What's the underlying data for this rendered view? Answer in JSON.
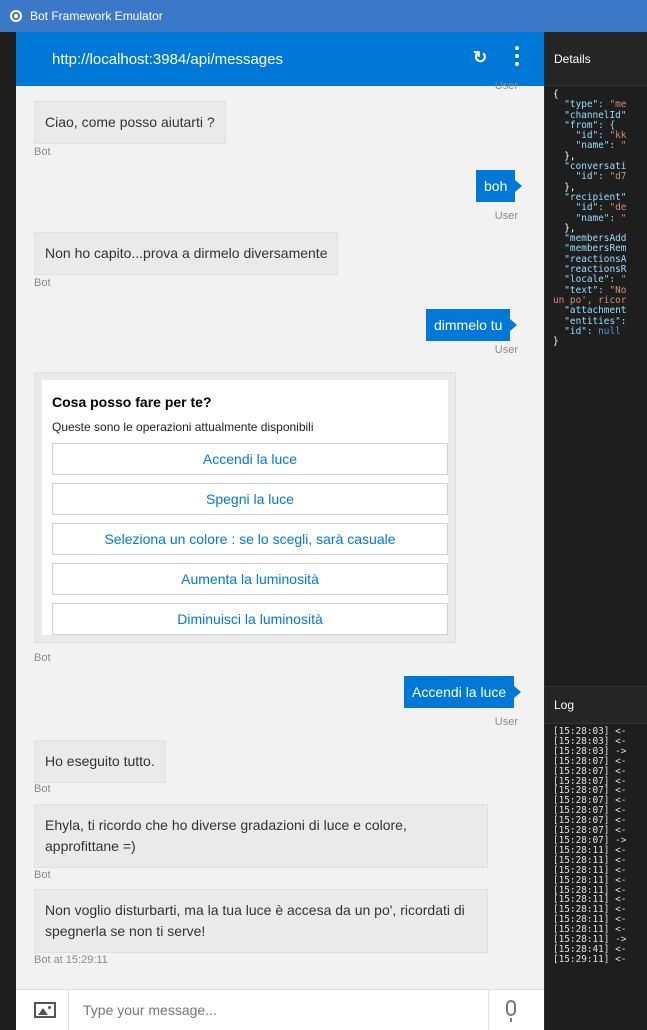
{
  "window": {
    "title": "Bot Framework Emulator"
  },
  "chat": {
    "endpoint": "http://localhost:3984/api/messages",
    "composer_placeholder": "Type your message...",
    "user_label": "User",
    "bot_label": "Bot",
    "last_bot_label": "Bot at 15:29:11",
    "messages": {
      "m1": "Ciao, come posso aiutarti ?",
      "m2": "boh",
      "m3": "Non ho capito...prova a dirmelo diversamente",
      "m4": "dimmelo tu",
      "m5": "Accendi la luce",
      "m6": "Ho eseguito tutto.",
      "m7": "Ehyla, ti ricordo che ho diverse gradazioni di luce e colore, approfittane =)",
      "m8": "Non voglio disturbarti, ma la tua luce è accesa da un po', ricordati di spegnerla se non ti serve!"
    },
    "card": {
      "title": "Cosa posso fare per te?",
      "subtitle": "Queste sono le operazioni attualmente disponibili",
      "buttons": [
        "Accendi la luce",
        "Spegni la luce",
        "Seleziona un colore : se lo scegli, sarà casuale",
        "Aumenta la luminosità",
        "Diminuisci la luminosità"
      ]
    }
  },
  "details": {
    "title": "Details",
    "json_lines": [
      [
        "{",
        ""
      ],
      [
        "  \"type\": ",
        "\"me"
      ],
      [
        "  \"channelId\"",
        ""
      ],
      [
        "  \"from\": {",
        ""
      ],
      [
        "    \"id\": ",
        "\"kk"
      ],
      [
        "    \"name\": ",
        "\""
      ],
      [
        "  },",
        ""
      ],
      [
        "  \"conversati",
        ""
      ],
      [
        "    \"id\": ",
        "\"d7"
      ],
      [
        "  },",
        ""
      ],
      [
        "  \"recipient\"",
        ""
      ],
      [
        "    \"id\": ",
        "\"de"
      ],
      [
        "    \"name\": ",
        "\""
      ],
      [
        "  },",
        ""
      ],
      [
        "  \"membersAdd",
        ""
      ],
      [
        "  \"membersRem",
        ""
      ],
      [
        "  \"reactionsA",
        ""
      ],
      [
        "  \"reactionsR",
        ""
      ],
      [
        "  \"locale\": ",
        "\""
      ],
      [
        "  \"text\": ",
        "\"No"
      ],
      [
        "",
        "un po', ricor"
      ],
      [
        "  \"attachment",
        ""
      ],
      [
        "  \"entities\":",
        ""
      ],
      [
        "  \"id\": ",
        "null"
      ],
      [
        "}",
        ""
      ]
    ]
  },
  "log": {
    "title": "Log",
    "entries": [
      "[15:28:03] <-",
      "[15:28:03] <-",
      "[15:28:03] ->",
      "[15:28:07] <-",
      "[15:28:07] <-",
      "[15:28:07] <-",
      "[15:28:07] <-",
      "[15:28:07] <-",
      "[15:28:07] <-",
      "[15:28:07] <-",
      "[15:28:07] <-",
      "[15:28:07] ->",
      "[15:28:11] <-",
      "[15:28:11] <-",
      "[15:28:11] <-",
      "[15:28:11] <-",
      "[15:28:11] <-",
      "[15:28:11] <-",
      "[15:28:11] <-",
      "[15:28:11] <-",
      "[15:28:11] <-",
      "[15:28:11] ->",
      "[15:28:41] <-",
      "[15:29:11] <-"
    ]
  }
}
